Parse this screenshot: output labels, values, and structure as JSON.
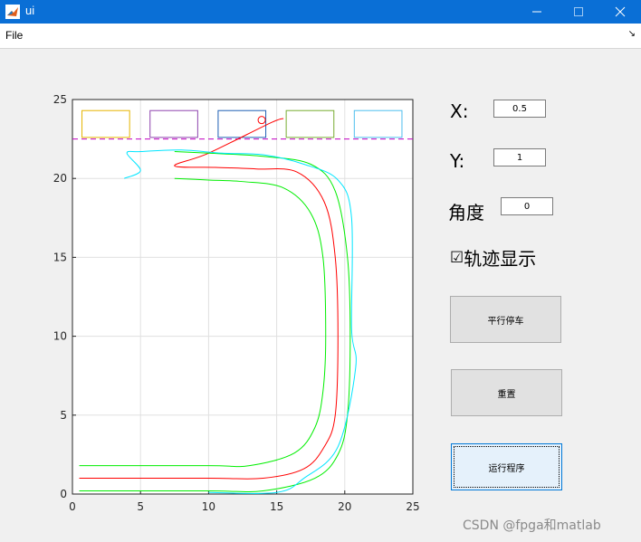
{
  "window": {
    "title": "ui",
    "minimize_icon": "minimize-icon",
    "maximize_icon": "maximize-icon",
    "close_icon": "close-icon"
  },
  "menu": {
    "file_label": "File",
    "undock_icon": "undock-arrow-icon"
  },
  "axes": {
    "xticks": [
      "0",
      "5",
      "10",
      "15",
      "20",
      "25"
    ],
    "yticks": [
      "0",
      "5",
      "10",
      "15",
      "20",
      "25"
    ],
    "xlim": [
      0,
      25
    ],
    "ylim": [
      0,
      25
    ],
    "grid": true
  },
  "controls": {
    "x_label": "X:",
    "x_value": "0.5",
    "y_label": "Y:",
    "y_value": "1",
    "angle_label": "角度",
    "angle_value": "0",
    "trajectory_checkbox_glyph": "☑",
    "trajectory_label": "轨迹显示",
    "trajectory_checked": true,
    "parallel_parking_button": "平行停车",
    "reset_button": "重置",
    "run_button": "运行程序"
  },
  "watermark": "CSDN @fpga和matlab",
  "colors": {
    "titlebar": "#0a6fd6",
    "path_red": "#ff0000",
    "path_green": "#00ee00",
    "path_cyan": "#00e5ff",
    "boundary_dash": "#c000c0"
  },
  "chart_data": {
    "type": "line",
    "xlim": [
      0,
      25
    ],
    "ylim": [
      0,
      25
    ],
    "grid": true,
    "xticks": [
      0,
      5,
      10,
      15,
      20,
      25
    ],
    "yticks": [
      0,
      5,
      10,
      15,
      20,
      25
    ],
    "boundary_line_y": 22.5,
    "parking_slots": [
      {
        "x": [
          0.7,
          4.2
        ],
        "y": [
          22.6,
          24.3
        ],
        "color": "#e6b400"
      },
      {
        "x": [
          5.7,
          9.2
        ],
        "y": [
          22.6,
          24.3
        ],
        "color": "#8e44ad"
      },
      {
        "x": [
          10.7,
          14.2
        ],
        "y": [
          22.6,
          24.3
        ],
        "color": "#1f5fb5"
      },
      {
        "x": [
          15.7,
          19.2
        ],
        "y": [
          22.6,
          24.3
        ],
        "color": "#77ac30"
      },
      {
        "x": [
          20.7,
          24.2
        ],
        "y": [
          22.6,
          24.3
        ],
        "color": "#4dbeee"
      }
    ],
    "series": [
      {
        "color": "#ff0000",
        "x": [
          0.5,
          10,
          14,
          17,
          18.5,
          19.3,
          19.5,
          19.3,
          18.5,
          16.5,
          13.5,
          10.5,
          7.5,
          10,
          14.5,
          15.5
        ],
        "y": [
          1,
          1,
          1,
          1.6,
          3,
          5,
          10,
          15,
          18.5,
          20.4,
          20.6,
          20.7,
          20.8,
          21.6,
          23.5,
          23.8
        ]
      },
      {
        "color": "#00ee00",
        "x": [
          0.5,
          10,
          13,
          16.3,
          17.8,
          18.4,
          18.6,
          18.4,
          17.5,
          15.5,
          12.5,
          10,
          7.5
        ],
        "y": [
          1.8,
          1.8,
          1.8,
          2.6,
          4.2,
          6.5,
          10,
          15,
          17.8,
          19.4,
          19.8,
          19.9,
          20
        ]
      },
      {
        "color": "#00ee00",
        "x": [
          0.5,
          10,
          14,
          17.8,
          19.5,
          20.2,
          20.4,
          20.2,
          19.3,
          17.5,
          14,
          10,
          7.5
        ],
        "y": [
          0.2,
          0.2,
          0.2,
          1,
          2.5,
          5,
          10,
          15,
          19.2,
          20.9,
          21.4,
          21.6,
          21.7
        ]
      },
      {
        "color": "#00e5ff",
        "x": [
          10,
          15,
          17,
          19.5,
          20.8,
          20.5,
          20.5,
          19.5,
          17,
          14,
          11,
          8,
          5,
          4,
          5,
          3.8
        ],
        "y": [
          0.1,
          0.1,
          1,
          3,
          8,
          10.5,
          17.5,
          19.9,
          20.9,
          21.5,
          21.6,
          21.8,
          21.7,
          21.6,
          20.5,
          20
        ]
      }
    ],
    "marker": {
      "x": 13.9,
      "y": 23.7,
      "shape": "circle",
      "color": "#ff0000"
    }
  }
}
